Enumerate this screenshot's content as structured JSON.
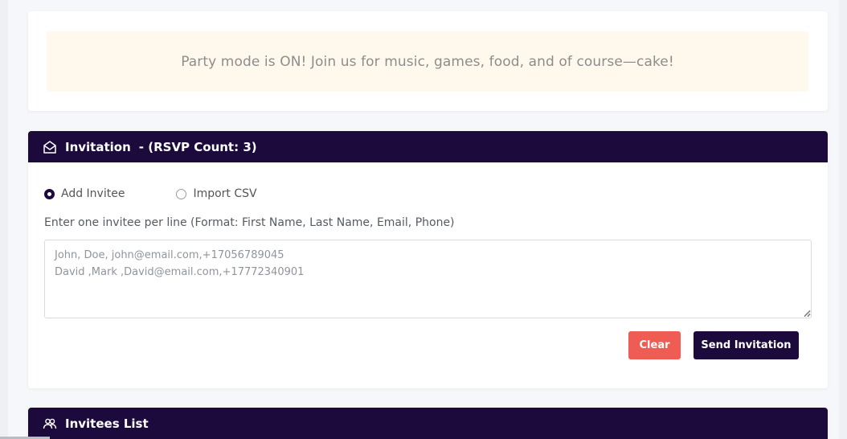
{
  "banner": {
    "message": "Party mode is ON! Join us for music, games, food, and of course—cake!"
  },
  "invitation": {
    "icon": "envelope-open-icon",
    "title": "Invitation",
    "rsvp_count": "- (RSVP Count: 3)",
    "options": [
      {
        "label": "Add Invitee",
        "checked": true
      },
      {
        "label": "Import CSV",
        "checked": false
      }
    ],
    "hint": "Enter one invitee per line (Format: First Name, Last Name, Email, Phone)",
    "textarea_placeholder": "John, Doe, john@email.com,+17056789045\nDavid ,Mark ,David@email.com,+17772340901",
    "textarea_value": "",
    "clear_label": "Clear",
    "send_label": "Send Invitation"
  },
  "invitees_list": {
    "icon": "users-icon",
    "title": "Invitees List"
  },
  "colors": {
    "header_bg": "#1c0a3d",
    "clear_btn": "#ee5c54",
    "banner_bg": "#fff8ec"
  }
}
